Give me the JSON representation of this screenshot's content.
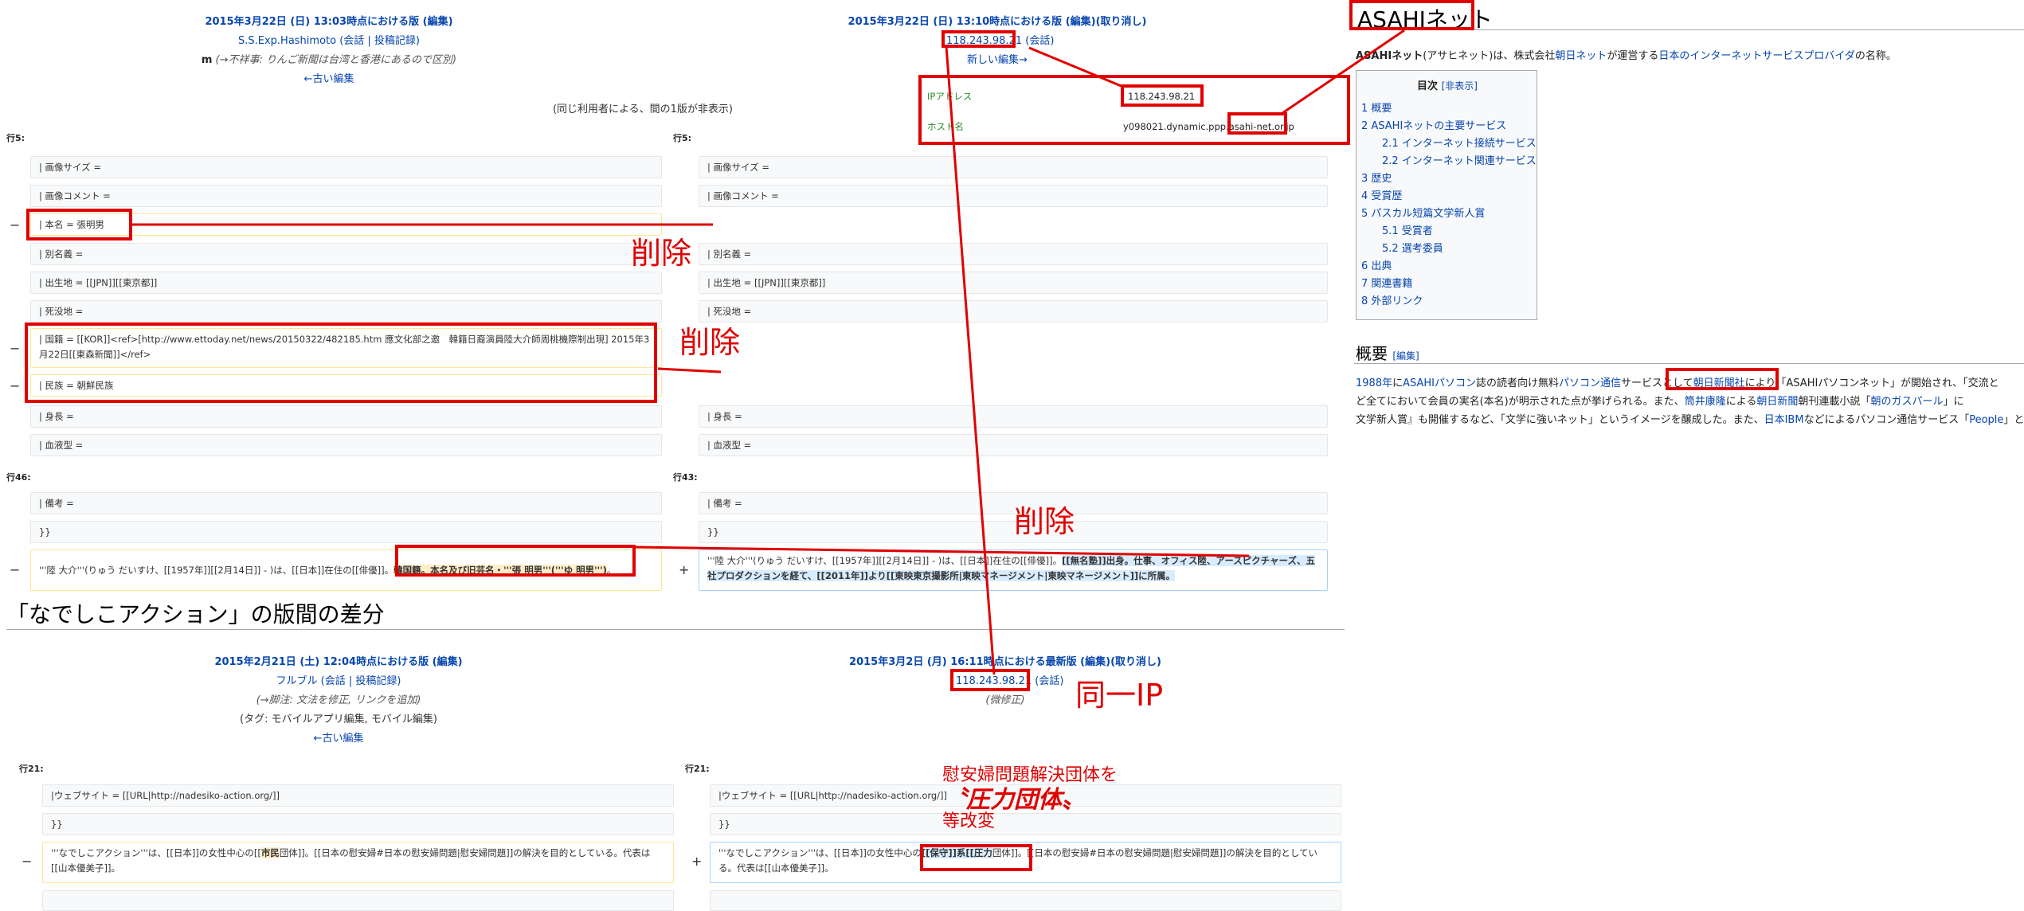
{
  "diff1": {
    "left": {
      "rev": "2015年3月22日 (日) 13:03時点における版",
      "edit": "(編集)",
      "user": "S.S.Exp.Hashimoto",
      "user_links": "(会話 | 投稿記録)",
      "minor": "m",
      "summary_prefix": "(→不祥事:",
      "summary_text": "りんご新聞は台湾と香港にあるので区別)",
      "older": "←古い編集",
      "line_label_1": "行5:",
      "line_label_2": "行46:"
    },
    "right": {
      "rev": "2015年3月22日 (日) 13:10時点における版",
      "edit": "(編集)",
      "undo": "(取り消し)",
      "ip": "118.243.98.21",
      "talk": "(会話)",
      "newer": "新しい編集→",
      "line_label_1": "行5:",
      "line_label_2": "行43:"
    },
    "hidden_note": "(同じ利用者による、間の1版が非表示)",
    "ipinfo": {
      "ip_label": "IPアドレス",
      "ip_value": "118.243.98.21",
      "host_label": "ホスト名",
      "host_prefix": "y098021.dynamic.ppp.",
      "host_domain": "asahi-net.or.jp"
    },
    "left_rows": [
      "| 画像サイズ =",
      "| 画像コメント =",
      "| 本名 = 張明男",
      "| 別名義 =",
      "| 出生地 = [[JPN]][[東京都]]",
      "| 死没地 =",
      "| 国籍 = [[KOR]]<ref>[http://www.ettoday.net/news/20150322/482185.htm 應文化部之邀　韓籍日裔演員陸大介師周桃機際制出現] 2015年3月22日[[東森新聞]]</ref>",
      "| 民族 = 朝鮮民族",
      "| 身長 =",
      "| 血液型 =",
      "| 備考 =",
      "}}"
    ],
    "right_rows": [
      "| 画像サイズ =",
      "| 画像コメント =",
      "| 別名義 =",
      "| 出生地 = [[JPN]][[東京都]]",
      "| 死没地 =",
      "| 身長 =",
      "| 血液型 =",
      "| 備考 =",
      "}}"
    ],
    "last_left_pre": "'''陸 大介'''(りゅう だいすけ、[[1957年]][[2月14日]] - )は、[[日本]]在住の[[俳優]]。",
    "last_left_hl": "韓国籍。本名及び旧芸名・'''張 明男'''('''ゆ 明男''')",
    "last_left_post": "。",
    "last_right_pre": "'''陸 大介'''(りゅう だいすけ、[[1957年]][[2月14日]] - )は、[[日本]]在住の[[俳優]]。",
    "last_right_hl": "[[無名塾]]出身。仕事、オフィス陸、アースピクチャーズ、五社プロダクションを経て、[[2011年]]より[[東映東京撮影所|東映マネージメント|東映マネージメント]]に所属。",
    "minus": "−",
    "plus": "+"
  },
  "section_title": "「なでしこアクション」の版間の差分",
  "diff2": {
    "left": {
      "rev": "2015年2月21日 (土) 12:04時点における版",
      "edit": "(編集)",
      "user": "フルブル",
      "user_links": "(会話 | 投稿記録)",
      "summary_prefix": "(→脚注:",
      "summary_text": "文法を修正, リンクを追加)",
      "tags": "(タグ: モバイルアプリ編集, モバイル編集)",
      "older": "←古い編集",
      "line_label": "行21:"
    },
    "right": {
      "rev": "2015年3月2日 (月) 16:11時点における最新版",
      "edit": "(編集)",
      "undo": "(取り消し)",
      "ip": "118.243.98.21",
      "talk": "(会話)",
      "summary": "(微修正)",
      "line_label": "行21:"
    },
    "rows": [
      "|ウェブサイト = [[URL|http://nadesiko-action.org/]]",
      "}}"
    ],
    "last_left_pre": "'''なでしこアクション'''は、[[日本]]の女性中心の[[",
    "last_left_hl": "市民",
    "last_left_post": "団体]]。[[日本の慰安婦#日本の慰安婦問題|慰安婦問題]]の解決を目的としている。代表は[[山本優美子]]。",
    "last_right_pre": "'''なでしこアクション'''は、[[日本]]の女性中心の",
    "last_right_hl": "[[保守]]系[[圧力",
    "last_right_post": "団体]]。[[日本の慰安婦#日本の慰安婦問題|慰安婦問題]]の解決を目的としている。代表は[[山本優美子]]。"
  },
  "wiki": {
    "title": "ASAHIネット",
    "intro_b": "ASAHIネット",
    "intro_1": "(アサヒネット)は、株式会社",
    "intro_link1": "朝日ネット",
    "intro_2": "が運営する",
    "intro_link2": "日本のインターネットサービスプロバイダ",
    "intro_3": "の名称。",
    "toc_title": "目次",
    "toc_toggle": "[非表示]",
    "toc": [
      "1 概要",
      "2 ASAHIネットの主要サービス",
      "2.1 インターネット接続サービス",
      "2.2 インターネット関連サービス",
      "3 歴史",
      "4 受賞歴",
      "5 パスカル短篇文学新人賞",
      "5.1 受賞者",
      "5.2 選考委員",
      "6 出典",
      "7 関連書籍",
      "8 外部リンク"
    ],
    "section": "概要",
    "section_edit": "[編集]",
    "p1_link1": "1988年",
    "p1_t1": "に",
    "p1_link2": "ASAHIパソコン",
    "p1_t2": "誌の読者向け無料",
    "p1_link3": "パソコン通信",
    "p1_t3": "サービスとして",
    "p1_link4": "朝日新聞社",
    "p1_t4": "により「ASAHIパソコンネット」が開始され、「交流と",
    "p2_t1": "ど全てにおいて会員の実名(本名)が明示された点が挙げられる。また、",
    "p2_link1": "筒井康隆",
    "p2_t2": "による",
    "p2_link2": "朝日新聞",
    "p2_t3": "朝刊連載小説「",
    "p2_link3": "朝のガスパール",
    "p2_t4": "」に",
    "p3_t1": "文学新人賞』も開催するなど、「文学に強いネット」というイメージを醸成した。また、",
    "p3_link1": "日本IBM",
    "p3_t2": "などによるパソコン通信サービス「",
    "p3_link2": "People",
    "p3_t3": "」と"
  },
  "annotations": {
    "delete1": "削除",
    "delete2": "削除",
    "delete3": "削除",
    "same_ip": "同一IP",
    "note_line1": "慰安婦問題解決団体を",
    "note_line2": "〝圧力団体〟",
    "note_line3": "等改変"
  },
  "colors": {
    "annotation": "#e00000",
    "link": "#0645ad",
    "deleted_border": "#ffe49c",
    "added_border": "#a3d3ff"
  }
}
